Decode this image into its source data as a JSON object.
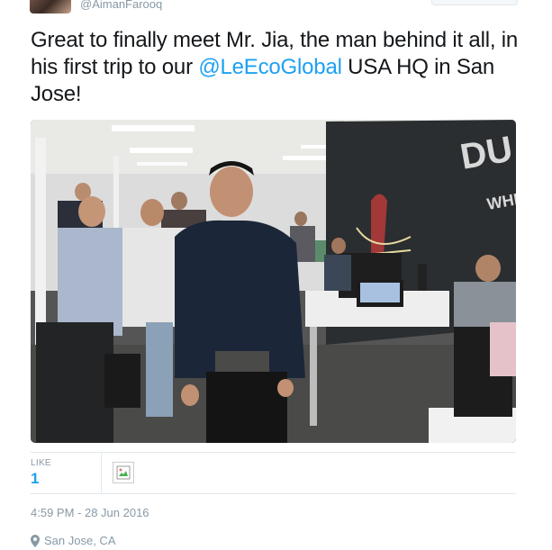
{
  "tweet": {
    "handle": "@AimanFarooq",
    "text_before": "Great to finally meet Mr. Jia, the man behind it all, in his first trip to our ",
    "mention": "@LeEcoGlobal",
    "text_after": " USA HQ in San Jose!",
    "photo_wall_text_1": "DU",
    "photo_wall_text_2": "WHE"
  },
  "stats": {
    "like_label": "LIKE",
    "like_count": "1"
  },
  "meta": {
    "timestamp": "4:59 PM - 28 Jun 2016",
    "location": "San Jose, CA"
  },
  "colors": {
    "link": "#1da1f2",
    "muted": "#8899a6",
    "border": "#e1e8ed"
  },
  "icons": {
    "location": "map-pin-icon",
    "liker_avatar": "broken-image-icon"
  }
}
